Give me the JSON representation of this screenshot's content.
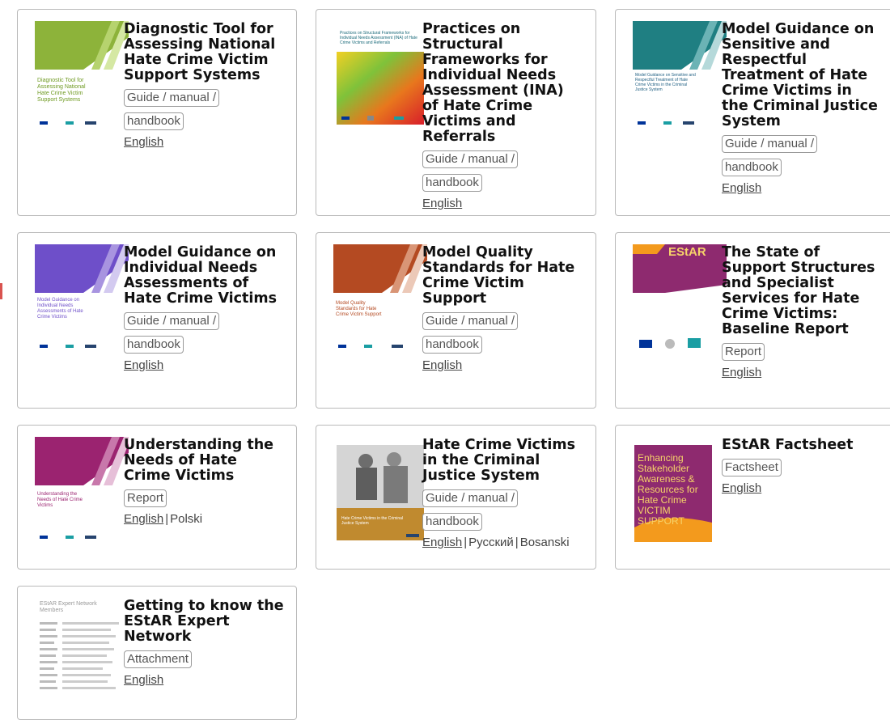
{
  "cards": [
    {
      "title": "Diagnostic Tool for Assessing National Hate Crime Victim Support Systems",
      "tags": [
        "Guide / manual /",
        "handbook"
      ],
      "languages": [
        "English"
      ],
      "cover": {
        "text": "Diagnostic Tool for Assessing National Hate Crime Victim Support Systems",
        "color": "#8db33a"
      }
    },
    {
      "title": "Practices on Structural Frameworks for Individual Needs Assessment (INA) of Hate Crime Victims and Referrals",
      "tags": [
        "Guide / manual /",
        "handbook"
      ],
      "languages": [
        "English"
      ],
      "cover": {
        "text": "Practices on Structural Frameworks for Individual Needs Assessment (INA) of Hate Crime Victims and Referrals",
        "color": "#e8771d"
      }
    },
    {
      "title": "Model Guidance on Sensitive and Respectful Treatment of Hate Crime Victims in the Criminal Justice System",
      "tags": [
        "Guide / manual /",
        "handbook"
      ],
      "languages": [
        "English"
      ],
      "cover": {
        "text": "Model Guidance on Sensitive and Respectful Treatment of Hate Crime Victims in the Criminal Justice System",
        "color": "#1f7f82"
      }
    },
    {
      "title": "Model Guidance on Individual Needs Assessments of Hate Crime Victims",
      "tags": [
        "Guide / manual /",
        "handbook"
      ],
      "languages": [
        "English"
      ],
      "cover": {
        "text": "Model Guidance on Individual Needs Assessments of Hate Crime Victims",
        "color": "#6e4fc9"
      }
    },
    {
      "title": "Model Quality Standards for Hate Crime Victim Support",
      "tags": [
        "Guide / manual /",
        "handbook"
      ],
      "languages": [
        "English"
      ],
      "cover": {
        "text": "Model Quality Standards for Hate Crime Victim Support",
        "color": "#b44a22"
      }
    },
    {
      "title": "The State of Support Structures and Specialist Services for Hate Crime Victims: Baseline Report",
      "tags": [
        "Report"
      ],
      "languages": [
        "English"
      ],
      "cover": {
        "text": "EStAR",
        "color": "#8e2a6f"
      }
    },
    {
      "title": "Understanding the Needs of Hate Crime Victims",
      "tags": [
        "Report"
      ],
      "languages": [
        "English",
        "Polski"
      ],
      "cover": {
        "text": "Understanding the Needs of Hate Crime Victims",
        "color": "#9b2370"
      }
    },
    {
      "title": "Hate Crime Victims in the Criminal Justice System",
      "tags": [
        "Guide / manual /",
        "handbook"
      ],
      "languages": [
        "English",
        "Русский",
        "Bosanski"
      ],
      "cover": {
        "text": "Hate Crime Victims in the Criminal Justice System",
        "color": "#c08a2f"
      }
    },
    {
      "title": "EStAR Factsheet",
      "tags": [
        "Factsheet"
      ],
      "languages": [
        "English"
      ],
      "cover": {
        "text": "Enhancing Stakeholder Awareness & Resources for Hate Crime VICTIM SUPPORT",
        "color": "#8e2a6f"
      }
    },
    {
      "title": "Getting to know the EStAR Expert Network",
      "tags": [
        "Attachment"
      ],
      "languages": [
        "English"
      ],
      "cover": {
        "text": "EStAR Expert Network Members",
        "color": "#9a9a9a"
      }
    }
  ],
  "colors": {
    "border": "#b9b9b9",
    "tag_border": "#9a9a9a",
    "link": "#444444",
    "accent_mark": "#d9534f"
  }
}
